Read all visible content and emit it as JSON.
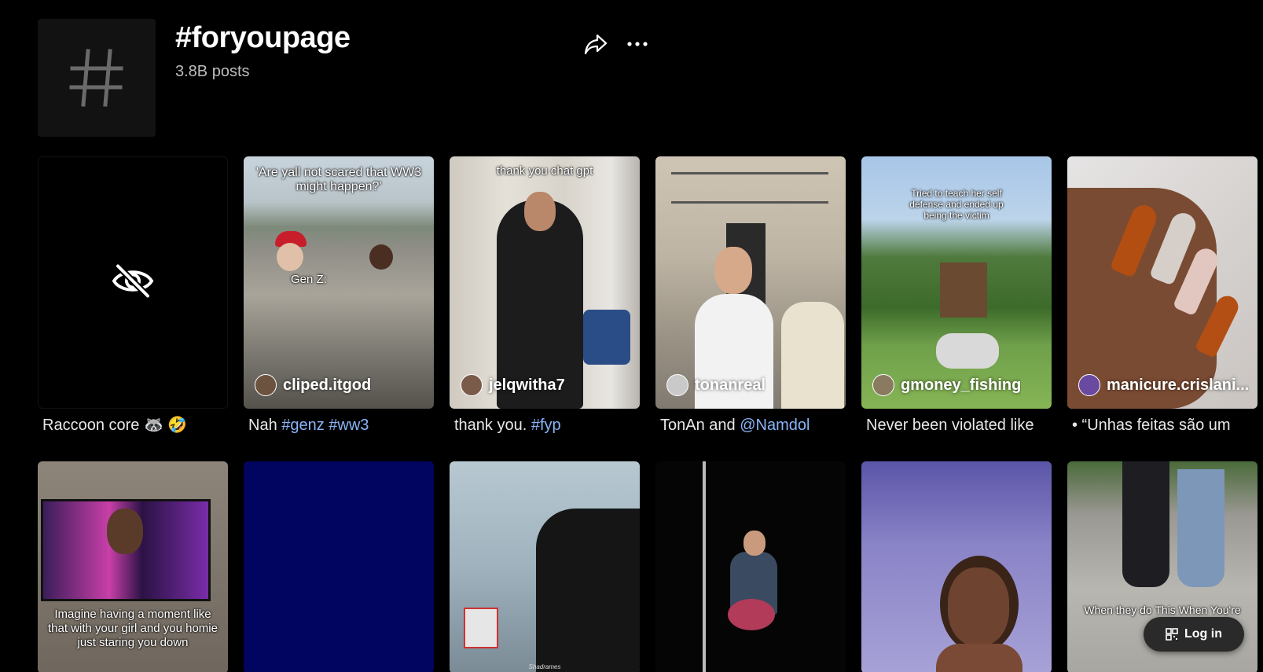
{
  "header": {
    "title": "#foryoupage",
    "post_count": "3.8B posts",
    "avatar_icon": "hash-icon",
    "share_icon": "share-arrow-icon",
    "more_icon": "more-dots-icon"
  },
  "videos_row1": [
    {
      "caption_text": "Raccoon core 🦝 🤣",
      "hidden": true,
      "icon": "eye-slash-icon"
    },
    {
      "author": "cliped.itgod",
      "overlay": "'Are yall not scared that WW3 might happen?'",
      "overlay2": "Gen Z:",
      "caption_prefix": "Nah ",
      "hashtags": "#genz #ww3"
    },
    {
      "author": "jelqwitha7",
      "overlay": "thank you chat gpt",
      "caption_prefix": "thank you. ",
      "hashtags": "#fyp"
    },
    {
      "author": "tonanreal",
      "caption_prefix": "TonAn and ",
      "hashtags": "@Namdol"
    },
    {
      "author": "gmoney_fishing",
      "overlay": "Tried to teach her self defense and ended up being the victim",
      "caption_text": "Never been violated like"
    },
    {
      "author": "manicure.crislani...",
      "caption_text": "• “Unhas feitas são um"
    }
  ],
  "videos_row2": [
    {
      "overlay": "Imagine having a moment like that with your girl and you homie just staring you down"
    },
    {},
    {
      "watermark": "Shadrames"
    },
    {},
    {},
    {
      "overlay": "When they do This When You're h..."
    }
  ],
  "login": {
    "label": "Log in",
    "icon": "qr-code-icon"
  },
  "colors": {
    "background": "#000000",
    "link": "#8ab4f8",
    "muted": "#bdbdbd"
  }
}
